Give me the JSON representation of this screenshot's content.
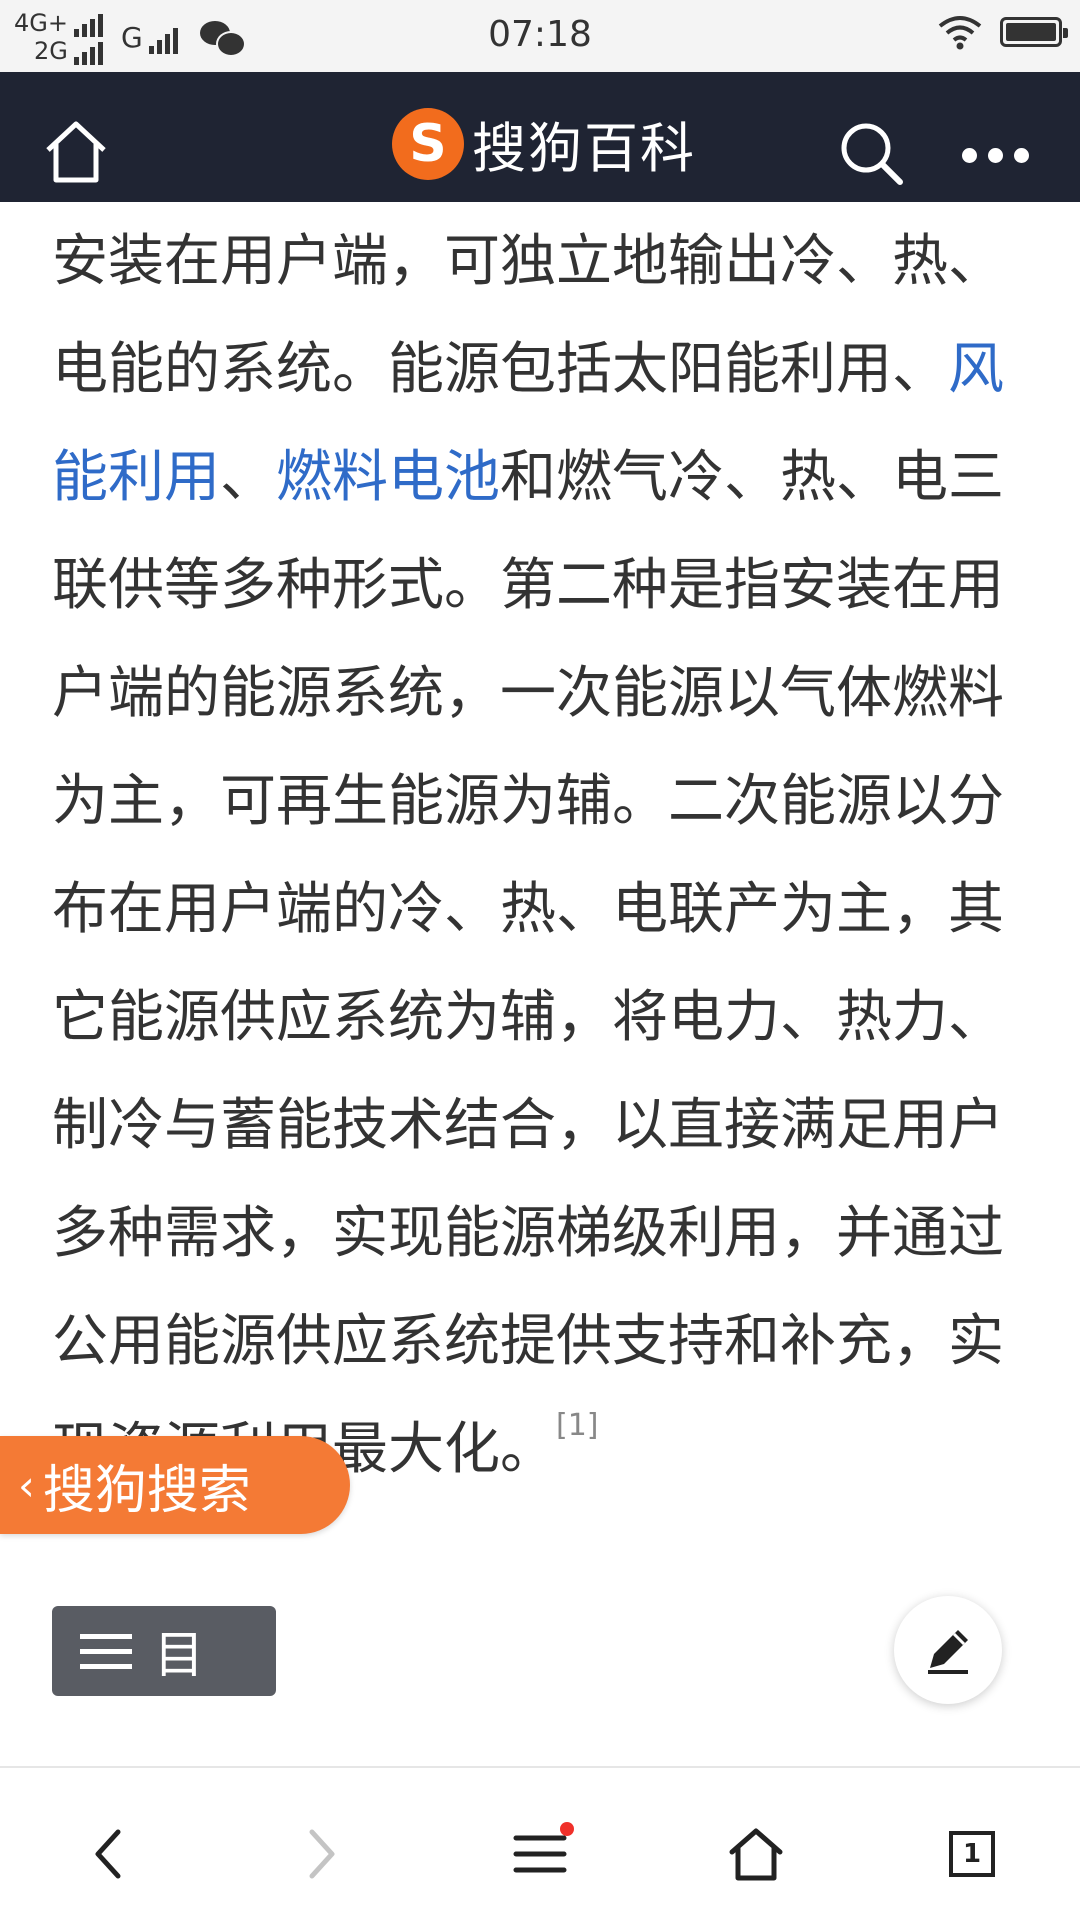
{
  "status_bar": {
    "network_1": "4G+",
    "network_2": "2G",
    "network_3": "G",
    "time": "07:18",
    "icons": [
      "signal-icon",
      "wechat-icon",
      "wifi-icon",
      "battery-icon"
    ]
  },
  "header": {
    "logo_letter": "S",
    "brand_name": "搜狗百科",
    "icons": [
      "home-icon",
      "search-icon",
      "more-icon"
    ]
  },
  "article": {
    "segments": [
      {
        "type": "text",
        "text": "安装在用户端，可独立地输出冷、热、电能的系统。能源包括太阳能利用、"
      },
      {
        "type": "link",
        "text": "风能利用"
      },
      {
        "type": "text",
        "text": "、"
      },
      {
        "type": "link",
        "text": "燃料电池"
      },
      {
        "type": "text",
        "text": "和燃气冷、热、电三联供等多种形式。第二种是指安装在用户端的能源系统，一次能源以气体燃料为主，可再生能源为辅。二次能源以分布在用户端的冷、热、电联产为主，其它能源供应系统为辅，将电力、热力、制冷与蓄能技术结合，以直接满足用户多种需求，实现能源梯级利用，并通过公用能源供应系统提供支持和补充，实现资源利用最大化。"
      },
      {
        "type": "sup",
        "text": "[1]"
      }
    ]
  },
  "floating": {
    "sogou_search_label": "搜狗搜索",
    "toc_label": "目"
  },
  "bottom_nav": {
    "tab_count": "1",
    "items": [
      "back-icon",
      "forward-icon",
      "menu-icon",
      "home-icon",
      "tabs-icon"
    ],
    "accent_color": "#f0302a"
  },
  "colors": {
    "header_bg": "#1f2433",
    "brand_orange": "#f26c1d",
    "link_blue": "#2f6bc8",
    "text": "#333333"
  }
}
